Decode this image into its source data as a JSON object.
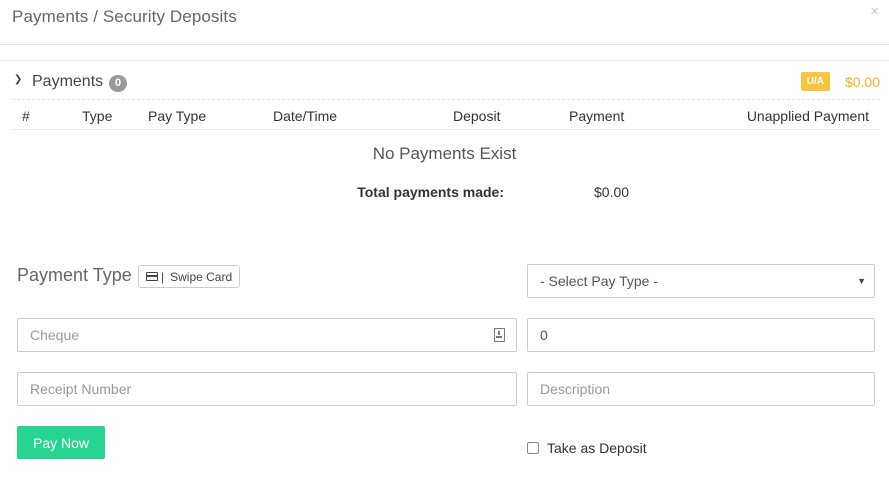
{
  "modal": {
    "title": "Payments / Security Deposits",
    "close_glyph": "×"
  },
  "payments": {
    "title": "Payments",
    "count": "0",
    "ua_badge": "U/A",
    "ua_amount": "$0.00",
    "columns": [
      "#",
      "Type",
      "Pay Type",
      "Date/Time",
      "Deposit",
      "Payment",
      "Unapplied Payment"
    ],
    "empty_message": "No Payments Exist",
    "total_label": "Total payments made:",
    "total_value": "$0.00"
  },
  "form": {
    "payment_type_label": "Payment Type",
    "swipe_label": "Swipe Card",
    "swipe_separator": "|",
    "pay_type_select": "- Select Pay Type -",
    "cheque_placeholder": "Cheque",
    "amount_value": "0",
    "receipt_placeholder": "Receipt Number",
    "description_placeholder": "Description",
    "pay_now_label": "Pay Now",
    "deposit_label": "Take as Deposit"
  },
  "colors": {
    "accent_green": "#27d490",
    "ua_yellow": "#f6c642",
    "ua_amount": "#f0b21e",
    "badge_gray": "#9a9a9a"
  }
}
